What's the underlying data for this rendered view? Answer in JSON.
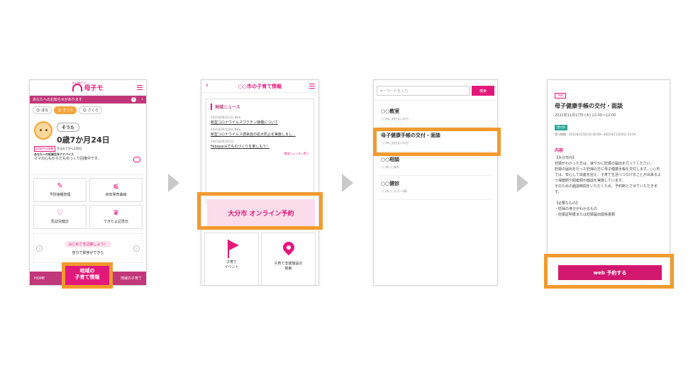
{
  "colors": {
    "accent": "#e2197a",
    "highlight": "#f29a2e",
    "arrow": "#c9c9c9",
    "teal": "#2ea89a"
  },
  "screen1": {
    "logo": "母子モ",
    "logo_sub": "母子手帳アプリ",
    "bar_text": "あなたへのお知らせがあります",
    "bar_count": "1",
    "kid_tabs": [
      "ほな",
      "そうた",
      "さくら"
    ],
    "child_name": "そうた",
    "child_age": "0歳7か月24日",
    "child_dob": "生まれてから230日",
    "child_tag": "記録中の体験",
    "advice_title": "あなたへの妊娠生年アドバイス",
    "advice_body": "ママの心もからだもゆっくり回復中です。",
    "grid": [
      {
        "label": "予防接種管理",
        "icon": "syringe-icon",
        "glyph": "✎"
      },
      {
        "label": "身体発育曲線",
        "icon": "growth-chart-icon",
        "glyph": "⫹"
      },
      {
        "label": "乳幼児健診",
        "icon": "stethoscope-icon",
        "glyph": "♡"
      },
      {
        "label": "できたよ記念日",
        "icon": "crown-icon",
        "glyph": "♛"
      }
    ],
    "banner_top": "はじめてを記録しよう！",
    "banner_bottom": "自分で飲食ができた",
    "foot_home": "HOME",
    "foot_mid": "地域の\n子育て情報",
    "foot_right": "地域の子育て"
  },
  "screen2": {
    "title": "○○市の子育て情報",
    "news_heading": "地域ニュース",
    "news": [
      {
        "date": "2021年06月11日 New",
        "text": "新型コロナウイルスワクチン接種について"
      },
      {
        "date": "2021年06月10日 New",
        "text": "新型コロナウイルス感染症の拡大防止を実施しまし..."
      },
      {
        "date": "2021年06月07日",
        "text": "Fabspaceでものづくりを楽しもう！"
      }
    ],
    "news_more": "地域ニュース一覧へ",
    "reserve_button": "大分市 オンライン予約",
    "tiles": [
      {
        "label": "子育て\nイベント"
      },
      {
        "label": "子育て支援施設の\n検索"
      }
    ]
  },
  "screen3": {
    "search_placeholder": "キーワードを入力",
    "search_button": "検索",
    "items": [
      {
        "title": "○○教室",
        "sub": "○○市にお住まいの方"
      },
      {
        "title": "母子健康手帳の交付・面談",
        "sub": "○○市にお住まいの方"
      },
      {
        "title": "○○相談",
        "sub": "○○市○○歳を"
      },
      {
        "title": "○○健診",
        "sub": "○○市○○ヶ月〜1歳"
      }
    ]
  },
  "screen4": {
    "tag": "予約",
    "title": "母子健康手帳の交付・面談",
    "date": "2022年11月17日 (木) 12:00〜12:00",
    "status": "受付中",
    "meta": "受付期間 : 2022年11月01日 00:00〜2022年11月16日 23:59",
    "section": "内容",
    "body": "【大分市内】\n妊娠がわかった方は、速やかに妊娠の届出を行ってください。\n妊娠の届出を行った妊婦の方に母子健康手帳を交付します。○○市では、安心して出産を迎え、子育て生活へつなげることが出来るよう保健師や助産師が面談を実施しています。\nそのための面談時間をいただくため、予約制とさせていただきます。\n\n【必要なもの】\n・妊婦の身分がわかるもの\n・妊娠証明書または妊娠届出関係書類",
    "reserve_button": "web 予約する"
  }
}
